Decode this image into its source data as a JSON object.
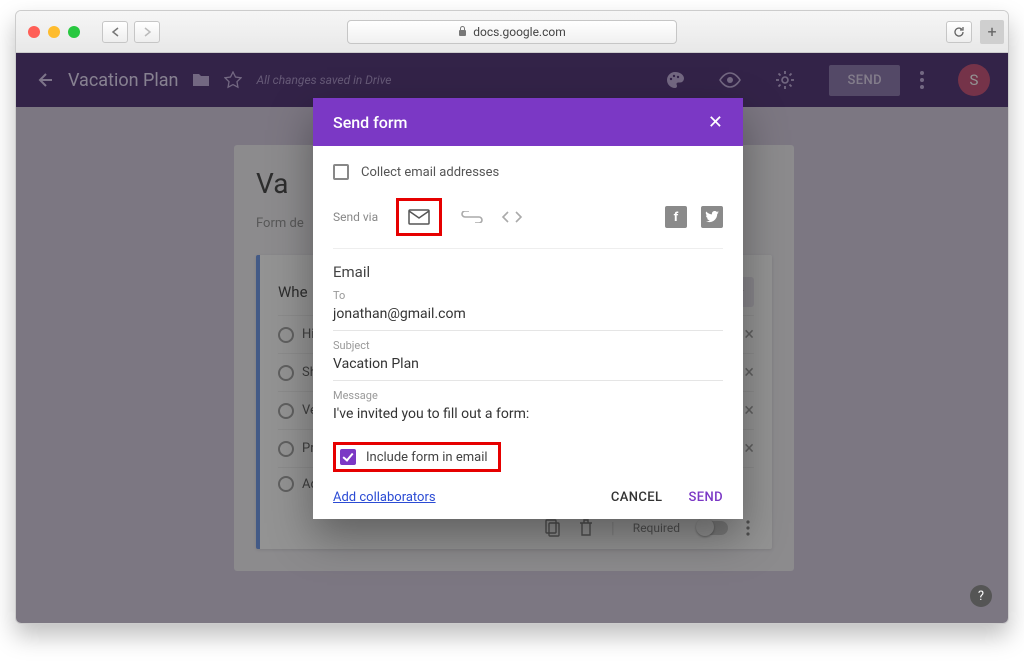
{
  "browser": {
    "url_host": "docs.google.com"
  },
  "header": {
    "title": "Vacation Plan",
    "saved_status": "All changes saved in Drive",
    "send_button": "SEND",
    "avatar_initial": "S"
  },
  "form": {
    "title_visible": "Va",
    "description": "Form de",
    "question_title_visible": "Whe",
    "options": [
      {
        "label": "Hi"
      },
      {
        "label": "Shi"
      },
      {
        "label": "Ve"
      },
      {
        "label": "Pra"
      },
      {
        "label": "Ad"
      }
    ],
    "footer": {
      "required_label": "Required"
    }
  },
  "dialog": {
    "title": "Send form",
    "collect_label": "Collect email addresses",
    "send_via_label": "Send via",
    "section_title": "Email",
    "fields": {
      "to_label": "To",
      "to_value": "jonathan@gmail.com",
      "subject_label": "Subject",
      "subject_value": "Vacation Plan",
      "message_label": "Message",
      "message_value": "I've invited you to fill out a form:"
    },
    "include_label": "Include form in email",
    "add_collaborators": "Add collaborators",
    "cancel": "CANCEL",
    "send": "SEND"
  }
}
